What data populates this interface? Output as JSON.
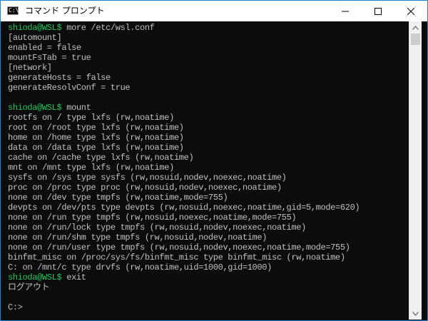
{
  "window": {
    "title": "コマンド プロンプト",
    "app_icon_glyph": "C:\\",
    "controls": {
      "minimize": "minimize",
      "maximize": "maximize",
      "close": "close"
    }
  },
  "colors": {
    "background": "#0c0c0c",
    "text": "#c0c0c0",
    "prompt": "#22c55e",
    "titlebar": "#ffffff",
    "border": "#1883d7"
  },
  "console": {
    "lines": [
      {
        "prompt": "shioda@WSL$",
        "text": " more /etc/wsl.conf"
      },
      {
        "prompt": "",
        "text": "[automount]"
      },
      {
        "prompt": "",
        "text": "enabled = false"
      },
      {
        "prompt": "",
        "text": "mountFsTab = true"
      },
      {
        "prompt": "",
        "text": "[network]"
      },
      {
        "prompt": "",
        "text": "generateHosts = false"
      },
      {
        "prompt": "",
        "text": "generateResolvConf = true"
      },
      {
        "prompt": "",
        "text": ""
      },
      {
        "prompt": "shioda@WSL$",
        "text": " mount"
      },
      {
        "prompt": "",
        "text": "rootfs on / type lxfs (rw,noatime)"
      },
      {
        "prompt": "",
        "text": "root on /root type lxfs (rw,noatime)"
      },
      {
        "prompt": "",
        "text": "home on /home type lxfs (rw,noatime)"
      },
      {
        "prompt": "",
        "text": "data on /data type lxfs (rw,noatime)"
      },
      {
        "prompt": "",
        "text": "cache on /cache type lxfs (rw,noatime)"
      },
      {
        "prompt": "",
        "text": "mnt on /mnt type lxfs (rw,noatime)"
      },
      {
        "prompt": "",
        "text": "sysfs on /sys type sysfs (rw,nosuid,nodev,noexec,noatime)"
      },
      {
        "prompt": "",
        "text": "proc on /proc type proc (rw,nosuid,nodev,noexec,noatime)"
      },
      {
        "prompt": "",
        "text": "none on /dev type tmpfs (rw,noatime,mode=755)"
      },
      {
        "prompt": "",
        "text": "devpts on /dev/pts type devpts (rw,nosuid,noexec,noatime,gid=5,mode=620)"
      },
      {
        "prompt": "",
        "text": "none on /run type tmpfs (rw,nosuid,noexec,noatime,mode=755)"
      },
      {
        "prompt": "",
        "text": "none on /run/lock type tmpfs (rw,nosuid,nodev,noexec,noatime)"
      },
      {
        "prompt": "",
        "text": "none on /run/shm type tmpfs (rw,nosuid,nodev,noatime)"
      },
      {
        "prompt": "",
        "text": "none on /run/user type tmpfs (rw,nosuid,nodev,noexec,noatime,mode=755)"
      },
      {
        "prompt": "",
        "text": "binfmt_misc on /proc/sys/fs/binfmt_misc type binfmt_misc (rw,noatime)"
      },
      {
        "prompt": "",
        "text": "C: on /mnt/c type drvfs (rw,noatime,uid=1000,gid=1000)"
      },
      {
        "prompt": "shioda@WSL$",
        "text": " exit"
      },
      {
        "prompt": "",
        "text": "ログアウト"
      },
      {
        "prompt": "",
        "text": ""
      },
      {
        "prompt": "",
        "text": "C:>"
      }
    ]
  },
  "scrollbar": {
    "up_icon": "chevron-up-icon",
    "down_icon": "chevron-down-icon"
  }
}
